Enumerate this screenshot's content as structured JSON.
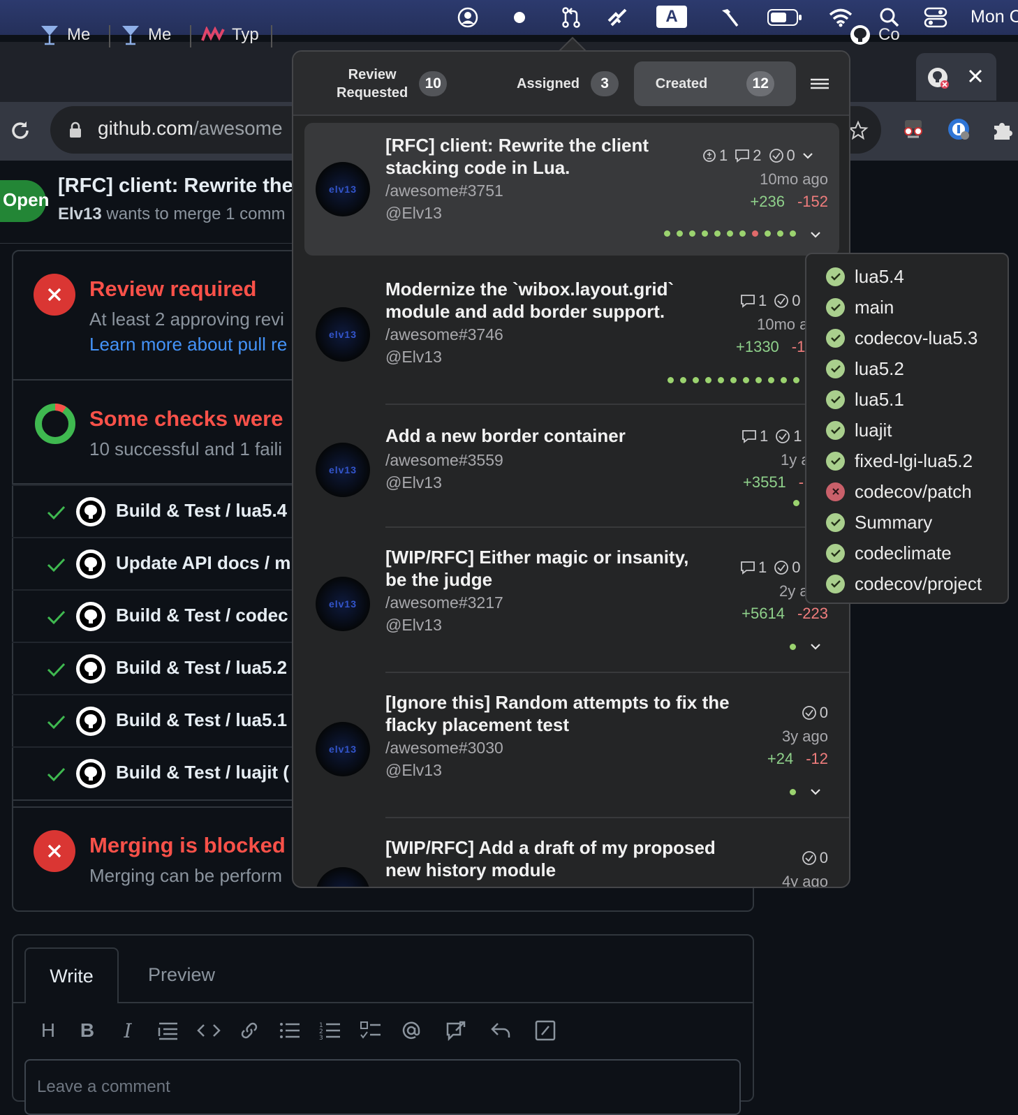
{
  "menubar": {
    "clock": "Mon C",
    "icons": [
      "account-icon",
      "record-dot-icon",
      "pull-request-icon",
      "app-icon",
      "input-source-icon",
      "hammer-icon",
      "battery-icon",
      "wifi-icon",
      "spotlight-icon",
      "control-center-icon"
    ],
    "input_source": "A"
  },
  "browser": {
    "tabs": [
      {
        "label": "Me",
        "icon": "martini-icon"
      },
      {
        "label": "Me",
        "icon": "martini-icon"
      },
      {
        "label": "Typ",
        "icon": "m-logo-icon"
      },
      {
        "label": "Co",
        "icon": "github-icon"
      }
    ],
    "url_host": "github.com",
    "url_path": "/awesome"
  },
  "github": {
    "status_badge": "Open",
    "pr_title": "[RFC] client: Rewrite the",
    "pr_subtitle_user": "Elv13",
    "pr_subtitle_text": " wants to merge 1 comm",
    "review": {
      "title": "Review required",
      "text": "At least 2 approving revi",
      "link": "Learn more about pull re"
    },
    "checks_summary": {
      "title": "Some checks were",
      "text": "10 successful and 1 faili"
    },
    "checks": [
      "Build & Test / lua5.4",
      "Update API docs / m",
      "Build & Test / codec",
      "Build & Test / lua5.2",
      "Build & Test / lua5.1",
      "Build & Test / luajit ("
    ],
    "merge": {
      "title": "Merging is blocked",
      "text": "Merging can be perform"
    },
    "comment": {
      "tab_write": "Write",
      "tab_preview": "Preview",
      "placeholder": "Leave a comment",
      "toolbar": [
        "heading-icon",
        "bold-icon",
        "italic-icon",
        "quote-icon",
        "code-icon",
        "link-icon",
        "bulleted-list-icon",
        "numbered-list-icon",
        "task-list-icon",
        "mention-icon",
        "reference-icon",
        "reply-icon",
        "slash-command-icon"
      ]
    }
  },
  "popover": {
    "tabs": [
      {
        "label_line1": "Review",
        "label_line2": "Requested",
        "count": "10"
      },
      {
        "label": "Assigned",
        "count": "3"
      },
      {
        "label": "Created",
        "count": "12",
        "selected": true
      }
    ],
    "pull_requests": [
      {
        "title_l1": "[RFC] client: Rewrite the client",
        "title_l2": "stacking code in Lua.",
        "ref": "/awesome#3751",
        "user": "@Elv13",
        "approvals": "1",
        "comments": "2",
        "checks": "0",
        "time": "10mo ago",
        "additions": "+236",
        "deletions": "-152",
        "dots": [
          "ok",
          "ok",
          "ok",
          "ok",
          "ok",
          "ok",
          "ok",
          "fail",
          "ok",
          "ok",
          "ok"
        ],
        "selected": true
      },
      {
        "title_l1": "Modernize the `wibox.layout.grid`",
        "title_l2": "module and add border support.",
        "ref": "/awesome#3746",
        "user": "@Elv13",
        "comments": "1",
        "checks": "0",
        "time": "10mo a",
        "additions": "+1330",
        "deletions": "-1",
        "dots": [
          "ok",
          "ok",
          "ok",
          "ok",
          "ok",
          "ok",
          "ok",
          "ok",
          "ok",
          "ok",
          "ok"
        ]
      },
      {
        "title_l1": "Add a new border container",
        "title_l2": "",
        "ref": "/awesome#3559",
        "user": "@Elv13",
        "comments": "1",
        "checks": "1",
        "time": "1y a",
        "additions": "+3551",
        "deletions": "-",
        "dots": [
          "ok"
        ]
      },
      {
        "title_l1": "[WIP/RFC] Either magic or insanity,",
        "title_l2": "be the judge",
        "ref": "/awesome#3217",
        "user": "@Elv13",
        "comments": "1",
        "checks": "0",
        "time": "2y a",
        "additions": "+5614",
        "deletions": "-223",
        "dots": [
          "ok"
        ]
      },
      {
        "title_l1": "[Ignore this] Random attempts to fix the",
        "title_l2": "flacky placement test",
        "ref": "/awesome#3030",
        "user": "@Elv13",
        "checks": "0",
        "time": "3y ago",
        "additions": "+24",
        "deletions": "-12",
        "dots": [
          "ok"
        ]
      },
      {
        "title_l1": "[WIP/RFC] Add a draft of my proposed",
        "title_l2": "new history module",
        "ref": "",
        "user": "",
        "checks": "0",
        "time": "4y ago",
        "additions": "",
        "deletions": "",
        "dots": []
      }
    ],
    "check_menu": [
      {
        "name": "lua5.4",
        "status": "success"
      },
      {
        "name": "main",
        "status": "success"
      },
      {
        "name": "codecov-lua5.3",
        "status": "success"
      },
      {
        "name": "lua5.2",
        "status": "success"
      },
      {
        "name": "lua5.1",
        "status": "success"
      },
      {
        "name": "luajit",
        "status": "success"
      },
      {
        "name": "fixed-lgi-lua5.2",
        "status": "success"
      },
      {
        "name": "codecov/patch",
        "status": "failure"
      },
      {
        "name": "Summary",
        "status": "success"
      },
      {
        "name": "codeclimate",
        "status": "success"
      },
      {
        "name": "codecov/project",
        "status": "success"
      }
    ]
  }
}
